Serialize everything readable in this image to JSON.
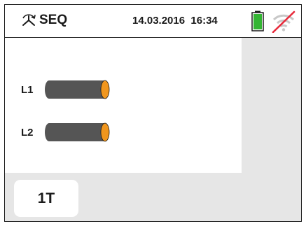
{
  "header": {
    "mode_label": "SEQ",
    "datetime": "14.03.2016  16:34",
    "icons": {
      "mode": "phase-sequence-icon",
      "battery": "battery-full-icon",
      "wifi": "wifi-disabled-icon"
    },
    "battery_color": "#33b533",
    "wifi_slash_color": "#e8293a"
  },
  "main": {
    "lines": [
      {
        "label": "L1",
        "icon": "cable-probe-icon"
      },
      {
        "label": "L2",
        "icon": "cable-probe-icon"
      }
    ],
    "cable_color": "#555555",
    "cable_end_color": "#f0961e"
  },
  "footer": {
    "tab_label": "1T"
  }
}
